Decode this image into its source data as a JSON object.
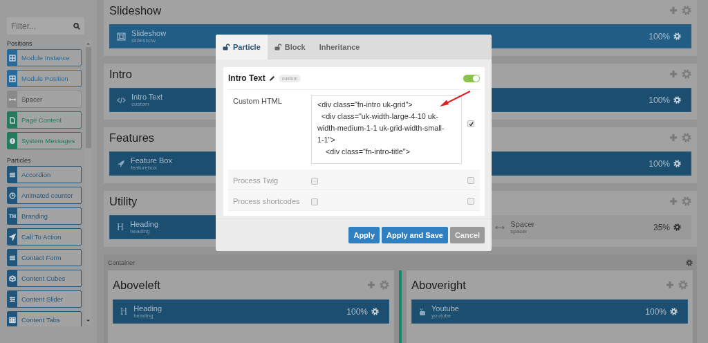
{
  "sidebar": {
    "filter": {
      "placeholder": "Filter..."
    },
    "groups": [
      {
        "title": "Positions",
        "items": [
          {
            "label": "Module Instance",
            "color": "#2a6a98"
          },
          {
            "label": "Module Position",
            "color": "#2a6a98"
          },
          {
            "label": "Spacer",
            "color": "#8a8a8a"
          },
          {
            "label": "Page Content",
            "color": "#257a5c"
          },
          {
            "label": "System Messages",
            "color": "#257a5c"
          }
        ]
      },
      {
        "title": "Particles",
        "items": [
          {
            "label": "Accordion",
            "color": "#22557a"
          },
          {
            "label": "Animated counter",
            "color": "#22557a"
          },
          {
            "label": "Branding",
            "color": "#22557a",
            "glyph": "TM"
          },
          {
            "label": "Call To Action",
            "color": "#22557a"
          },
          {
            "label": "Contact Form",
            "color": "#22557a"
          },
          {
            "label": "Content Cubes",
            "color": "#22557a"
          },
          {
            "label": "Content Slider",
            "color": "#22557a"
          },
          {
            "label": "Content Tabs",
            "color": "#22557a"
          }
        ]
      }
    ]
  },
  "sections": [
    {
      "title": "Slideshow",
      "blocks": [
        {
          "kind": "slideshow",
          "name": "Slideshow",
          "subtitle": "slideshow",
          "size": "100%"
        }
      ]
    },
    {
      "title": "Intro",
      "blocks": [
        {
          "kind": "custom",
          "name": "Intro Text",
          "subtitle": "custom",
          "size": "100%"
        }
      ]
    },
    {
      "title": "Features",
      "blocks": [
        {
          "kind": "featurebox",
          "name": "Feature Box",
          "subtitle": "featurebox",
          "size": "100%"
        }
      ]
    },
    {
      "title": "Utility",
      "blocks": [
        {
          "kind": "heading",
          "glyph": "H",
          "name": "Heading",
          "subtitle": "heading"
        },
        {
          "kind": "spacer",
          "name": "Spacer",
          "subtitle": "spacer",
          "size": "35%"
        }
      ]
    }
  ],
  "container": {
    "title": "Container",
    "columns": [
      {
        "title": "Aboveleft",
        "blocks": [
          {
            "kind": "heading",
            "glyph": "H",
            "name": "Heading",
            "subtitle": "heading",
            "size": "100%"
          }
        ]
      },
      {
        "title": "Aboveright",
        "blocks": [
          {
            "kind": "youtube",
            "name": "Youtube",
            "subtitle": "youtube",
            "size": "100%"
          }
        ]
      }
    ]
  },
  "modal": {
    "tabs": [
      {
        "label": "Particle",
        "selected": true
      },
      {
        "label": "Block",
        "selected": false
      },
      {
        "label": "Inheritance",
        "selected": false
      }
    ],
    "title": "Intro Text",
    "badge": "custom",
    "enabled": true,
    "fields": [
      {
        "kind": "textarea",
        "label": "Custom HTML",
        "value": "<div class=\"fn-intro uk-grid\">\n  <div class=\"uk-width-large-4-10 uk-width-medium-1-1 uk-grid-width-small-1-1\">\n    <div class=\"fn-intro-title\">",
        "disabled": false,
        "override": true
      },
      {
        "kind": "checkbox",
        "label": "Process Twig",
        "checked": false,
        "disabled": true,
        "override": false
      },
      {
        "kind": "checkbox",
        "label": "Process shortcodes",
        "checked": false,
        "disabled": true,
        "override": false
      }
    ],
    "buttons": [
      {
        "label": "Apply",
        "kind": "primary"
      },
      {
        "label": "Apply and Save",
        "kind": "primary"
      },
      {
        "label": "Cancel",
        "kind": "secondary"
      }
    ]
  }
}
